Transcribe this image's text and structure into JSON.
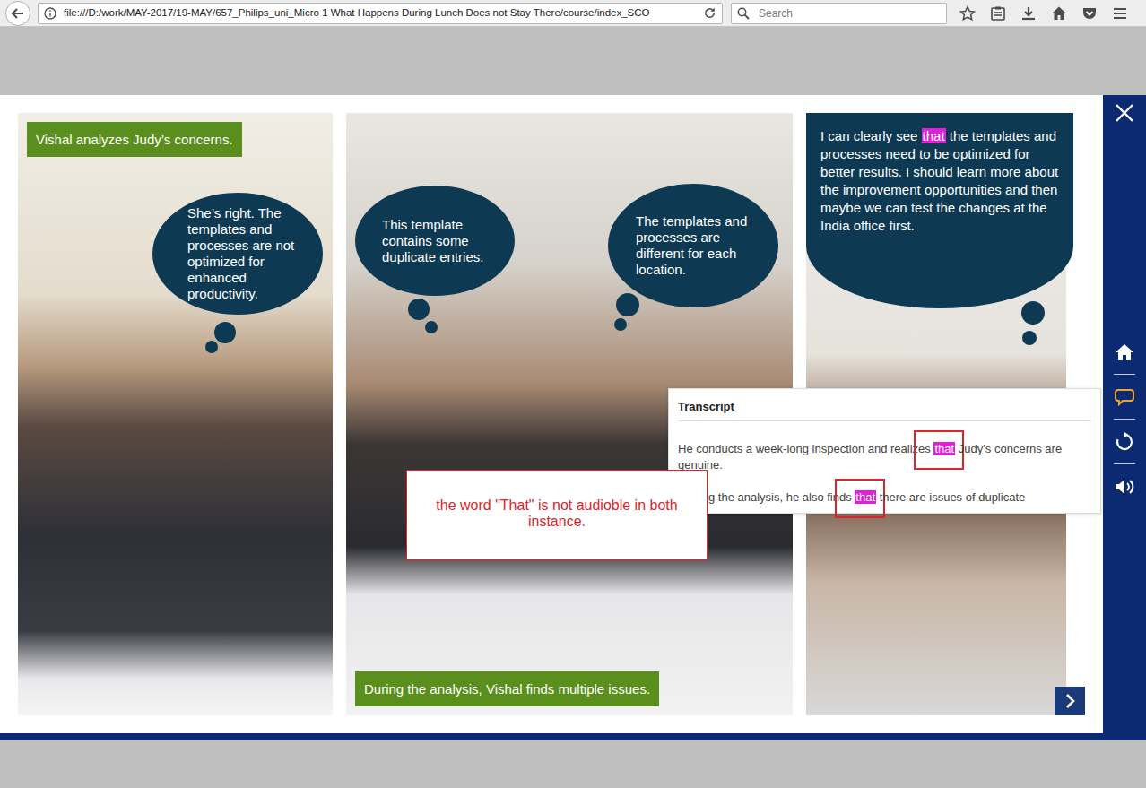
{
  "browser": {
    "url": "file:///D:/work/MAY-2017/19-MAY/657_Philips_uni_Micro 1 What Happens During Lunch Does not Stay There/course/index_SCO",
    "search": {
      "placeholder": "Search"
    }
  },
  "slide": {
    "panels": [
      {
        "caption": "Vishal analyzes Judy’s concerns.",
        "bubbles": [
          {
            "parts": [
              {
                "text": "She’s right. The templates and processes are not optimized for enhanced productivity.",
                "highlighted": false
              }
            ]
          }
        ]
      },
      {
        "caption": "During the analysis, Vishal finds multiple issues.",
        "bubbles": [
          {
            "parts": [
              {
                "text": "This template contains some duplicate entries.",
                "highlighted": false
              }
            ]
          },
          {
            "parts": [
              {
                "text": "The templates and processes are different for each location.",
                "highlighted": false
              }
            ]
          }
        ]
      },
      {
        "bubbles": [
          {
            "parts": [
              {
                "text": "I can clearly see ",
                "highlighted": false
              },
              {
                "text": "that",
                "highlighted": true
              },
              {
                "text": " the templates and processes need to be optimized for better results. I should learn more about the improvement opportunities and then maybe we can test the changes at the India office first.",
                "highlighted": false
              }
            ]
          }
        ]
      }
    ]
  },
  "transcript": {
    "title": "Transcript",
    "paragraphs": [
      [
        {
          "text": "He conducts a week-long inspection and realizes ",
          "highlighted": false,
          "flagged": false
        },
        {
          "text": "that",
          "highlighted": true,
          "flagged": true
        },
        {
          "text": " Judy’s concerns are genuine.",
          "highlighted": false,
          "flagged": false
        }
      ],
      [
        {
          "text": "g the analysis, he also finds ",
          "highlighted": false,
          "flagged": false
        },
        {
          "text": "that",
          "highlighted": true,
          "flagged": true
        },
        {
          "text": " there are issues of duplicate",
          "highlighted": false,
          "flagged": false
        }
      ]
    ]
  },
  "review_note": {
    "text": "the word \"That\" is not audioble in both instance."
  },
  "sidebar": {
    "items": [
      {
        "kind": "home",
        "selected": false
      },
      {
        "kind": "transcript",
        "selected": true
      },
      {
        "kind": "replay",
        "selected": false
      },
      {
        "kind": "audio",
        "selected": false
      }
    ]
  }
}
